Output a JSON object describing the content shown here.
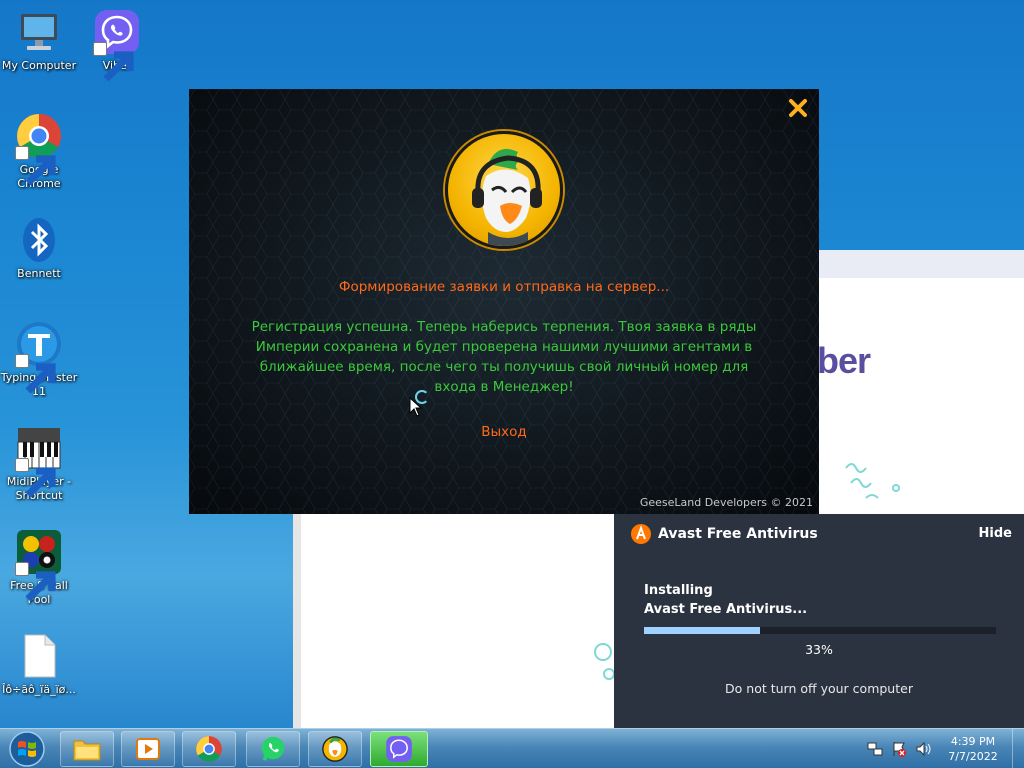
{
  "desktop": {
    "icons": [
      {
        "label": "My Computer",
        "icon": "computer-icon"
      },
      {
        "label": "Viber",
        "icon": "viber-icon"
      },
      {
        "label": "Google Chrome",
        "icon": "chrome-icon"
      },
      {
        "label": "Bennett",
        "icon": "bluetooth-icon"
      },
      {
        "label": "Typing Master 11",
        "icon": "typing-master-icon"
      },
      {
        "label": "MidiPlayer - Shortcut",
        "icon": "midi-piano-icon"
      },
      {
        "label": "Free 8 Ball Pool",
        "icon": "pool-balls-icon"
      },
      {
        "label": "Îô÷ãô_ïä_ïø...",
        "icon": "blank-file-icon"
      }
    ]
  },
  "background_window": {
    "logo_text": "ber",
    "brand_color": "#5a4ea0"
  },
  "dialog": {
    "status": "Формирование заявки и отправка на сервер...",
    "message": "Регистрация успешна. Теперь наберись терпения. Твоя заявка в ряды Империи сохранена и будет проверена нашими лучшими агентами в ближайшее время, после чего ты получишь свой личный номер для входа в Менеджер!",
    "exit_label": "Выход",
    "footer": "GeeseLand Developers © 2021",
    "close_icon": "close-icon",
    "avatar_icon": "goose-headphones-avatar",
    "status_color": "#ff6a1a",
    "message_color": "#3cc83c"
  },
  "avast": {
    "title": "Avast Free Antivirus",
    "hide_label": "Hide",
    "installing_line1": "Installing",
    "installing_line2": "Avast Free Antivirus...",
    "progress": 0.33,
    "percent_label": "33%",
    "warning": "Do not turn off your computer",
    "accent": "#ff7800"
  },
  "taskbar": {
    "items": [
      {
        "name": "explorer",
        "icon": "folder-icon"
      },
      {
        "name": "media-player",
        "icon": "media-player-icon"
      },
      {
        "name": "chrome",
        "icon": "chrome-icon"
      },
      {
        "name": "whatsapp",
        "icon": "whatsapp-icon"
      },
      {
        "name": "goose-app",
        "icon": "goose-app-icon"
      },
      {
        "name": "viber",
        "icon": "viber-icon"
      }
    ],
    "clock_time": "4:39 PM",
    "clock_date": "7/7/2022"
  }
}
